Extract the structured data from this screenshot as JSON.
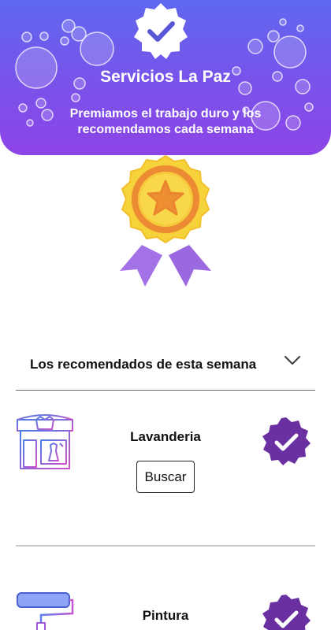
{
  "header": {
    "title": "Servicios La Paz",
    "subtitle": "Premiamos el trabajo duro y los recomendamos cada semana",
    "gradient_start": "#5f68f0",
    "gradient_end": "#8d44e6",
    "badge_icon": "verified-badge-icon"
  },
  "medal_icon": "award-medal-icon",
  "section": {
    "title": "Los recomendados de esta semana",
    "toggle_icon": "chevron-down-icon"
  },
  "services": [
    {
      "name": "Lavanderia",
      "action_label": "Buscar",
      "icon": "laundry-shop-icon",
      "verified_icon": "verified-badge-icon"
    },
    {
      "name": "Pintura",
      "icon": "paint-roller-icon",
      "verified_icon": "verified-badge-icon"
    }
  ],
  "colors": {
    "accent_purple": "#6a2fa0",
    "medal_gold": "#f5c52a",
    "medal_orange": "#ef8a2f",
    "ribbon": "#9e6fe0"
  }
}
